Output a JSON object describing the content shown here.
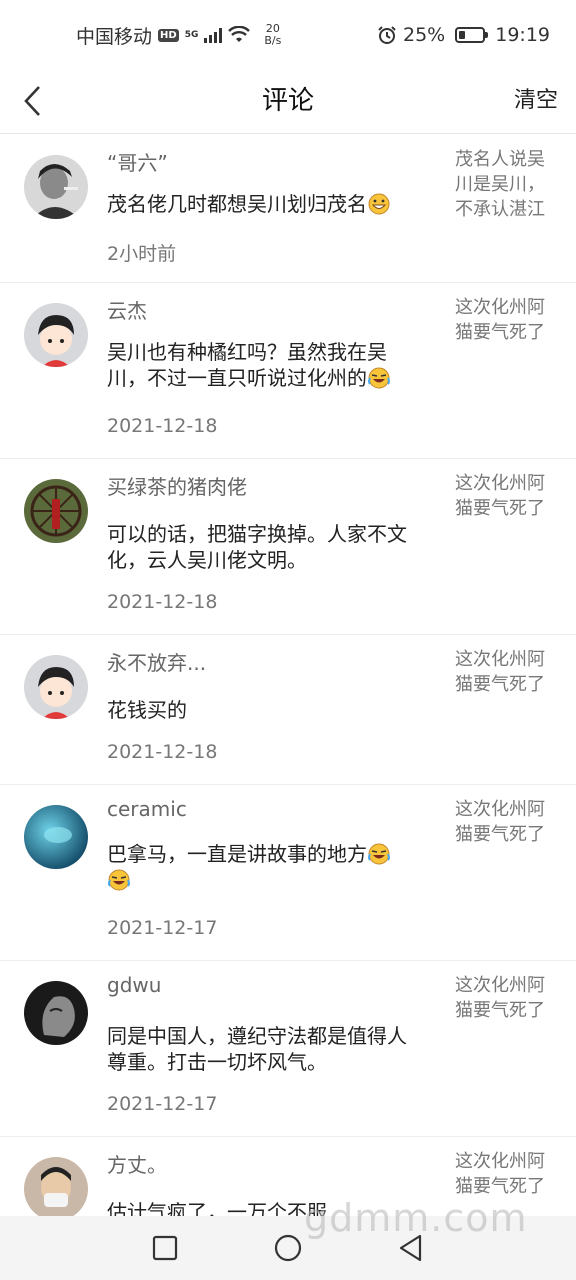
{
  "status_bar": {
    "carrier": "中国移动",
    "hd": "HD",
    "network": "5G",
    "speed_value": "20",
    "speed_unit": "B/s",
    "battery": "25%",
    "battery_level": 0.25,
    "time": "19:19"
  },
  "header": {
    "title": "评论",
    "clear_label": "清空"
  },
  "comments": [
    {
      "username": "“哥六”",
      "text": "茂名佬几时都想吴川划归茂名",
      "emoji": "grin-emoji",
      "date": "2小时前",
      "source": "茂名人说吴川是吴川，不承认湛江",
      "avatar_color": "#cfcfcf"
    },
    {
      "username": "云杰",
      "text": "吴川也有种橘红吗？虽然我在吴川，不过一直只听说过化州的",
      "emoji": "laugh-cry-emoji",
      "date": "2021-12-18",
      "source": "这次化州阿猫要气死了",
      "avatar_color": "#d6d8dc"
    },
    {
      "username": "买绿茶的猪肉佬",
      "text": "可以的话，把猫字换掉。人家不文化，云人吴川佬文明。",
      "date": "2021-12-18",
      "source": "这次化州阿猫要气死了",
      "avatar_color": "#7a5a3a"
    },
    {
      "username": "永不放弃...",
      "text": "花钱买的",
      "date": "2021-12-18",
      "source": "这次化州阿猫要气死了",
      "avatar_color": "#d6d8dc"
    },
    {
      "username": "ceramic",
      "text": "巴拿马，一直是讲故事的地方",
      "emoji": "laugh-cry-emoji",
      "emoji2": "laugh-cry-emoji",
      "date": "2021-12-17",
      "source": "这次化州阿猫要气死了",
      "avatar_color": "#1f7fa8"
    },
    {
      "username": "gdwu",
      "text": "同是中国人，遵纪守法都是值得人尊重。打击一切坏风气。",
      "date": "2021-12-17",
      "source": "这次化州阿猫要气死了",
      "avatar_color": "#2a2a2a"
    },
    {
      "username": "方丈。",
      "text": "估计气疯了，一万个不服",
      "date": "",
      "source": "这次化州阿猫要气死了",
      "avatar_color": "#c9b8a8"
    }
  ],
  "watermark": "gdmm.com",
  "colors": {
    "text_primary": "#222222",
    "text_secondary": "#777777",
    "divider": "#ededed"
  }
}
